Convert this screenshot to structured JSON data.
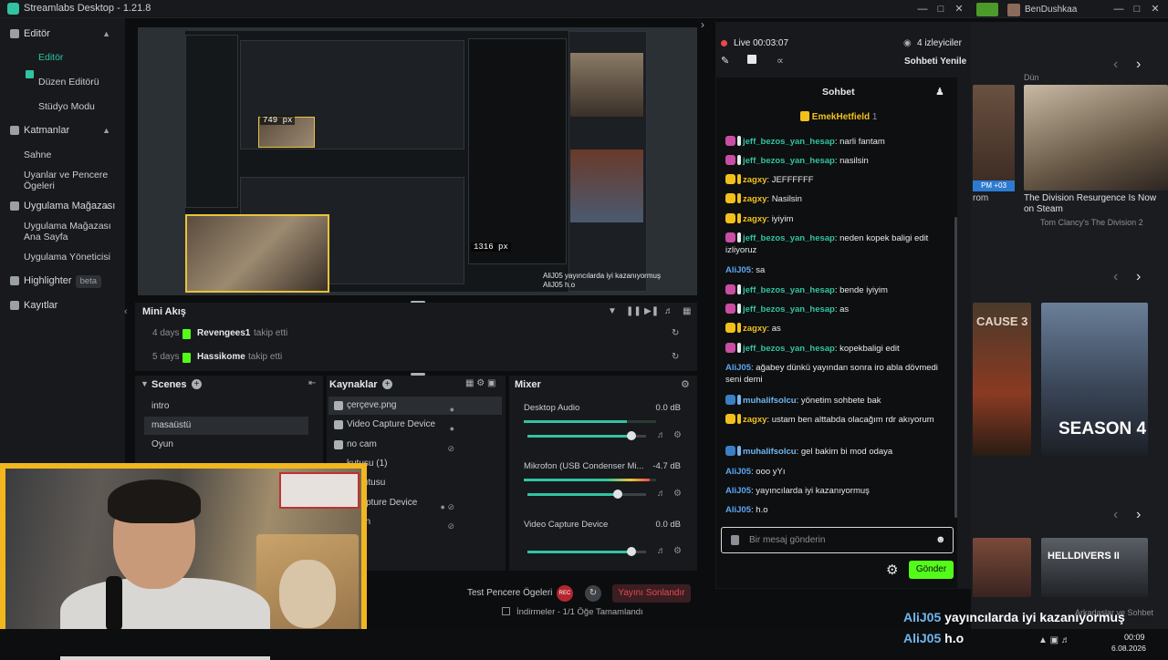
{
  "app": {
    "title": "Streamlabs Desktop - 1.21.8",
    "user": "BenDushkaa"
  },
  "sidebar": {
    "sections": [
      {
        "label": "Editör",
        "items": [
          "Editör",
          "Düzen Editörü",
          "Stüdyo Modu"
        ]
      },
      {
        "label": "Katmanlar",
        "items": [
          "Sahne",
          "Uyanlar ve Pencere Ögeleri"
        ]
      },
      {
        "label": "Uygulama Mağazası",
        "items": [
          "Uygulama Mağazası Ana Sayfa",
          "Uygulama Yöneticisi"
        ]
      }
    ],
    "highlighter": "Highlighter",
    "beta": "beta",
    "records": "Kayıtlar"
  },
  "preview": {
    "px_top": "749 px",
    "px_bottom": "1316 px",
    "inner_chat_1": "AliJ05 yayıncılarda iyi kazanıyormuş",
    "inner_chat_2": "AliJ05 h.o"
  },
  "minifeed": {
    "title": "Mini Akış",
    "rows": [
      {
        "days": "4 days",
        "name": "Revengees1",
        "action": "takip etti"
      },
      {
        "days": "5 days",
        "name": "Hassikome",
        "action": "takip etti"
      }
    ]
  },
  "scenes": {
    "title": "Scenes",
    "items": [
      "intro",
      "masaüstü",
      "Oyun"
    ],
    "selected": 1
  },
  "sources": {
    "title": "Kaynaklar",
    "items": [
      "çerçeve.png",
      "Video Capture Device",
      "no cam",
      "kutusu (1)",
      "et Kutusu",
      "o Capture Device",
      "Ekran",
      "kran"
    ]
  },
  "mixer": {
    "title": "Mixer",
    "channels": [
      {
        "name": "Desktop Audio",
        "db": "0.0 dB",
        "level": 0.78,
        "volume": 0.88
      },
      {
        "name": "Mikrofon (USB Condenser Mi...",
        "db": "-4.7 dB",
        "level": 0.95,
        "volume": 0.76
      },
      {
        "name": "Video Capture Device",
        "db": "0.0 dB",
        "level": 0,
        "volume": 0.88
      }
    ]
  },
  "controls": {
    "test": "Test Pencere Ögeleri",
    "rec": "REC",
    "end": "Yayını Sonlandır"
  },
  "live": {
    "status": "Live 00:03:07",
    "viewers": "4 izleyiciler",
    "refresh": "Sohbeti Yenile",
    "chat_title": "Sohbet",
    "pinned_user": "EmekHetfield",
    "pinned_count": "1"
  },
  "chat": [
    {
      "badge": "b-pink",
      "user": "jeff_bezos_yan_hesap",
      "cls": "u-green",
      "text": "narli fantam"
    },
    {
      "badge": "b-pink",
      "user": "jeff_bezos_yan_hesap",
      "cls": "u-green",
      "text": "nasilsin"
    },
    {
      "badge": "b-gold",
      "user": "zagxy",
      "cls": "u-gold",
      "text": "JEFFFFFF"
    },
    {
      "badge": "b-gold",
      "user": "zagxy",
      "cls": "u-gold",
      "text": "Nasilsin"
    },
    {
      "badge": "b-gold",
      "user": "zagxy",
      "cls": "u-gold",
      "text": "iyiyim"
    },
    {
      "badge": "b-pink",
      "user": "jeff_bezos_yan_hesap",
      "cls": "u-green",
      "text": "neden kopek baligi edit izliyoruz"
    },
    {
      "badge": "",
      "user": "AliJ05",
      "cls": "u-plain",
      "text": "sa"
    },
    {
      "badge": "b-pink",
      "user": "jeff_bezos_yan_hesap",
      "cls": "u-green",
      "text": "bende iyiyim"
    },
    {
      "badge": "b-pink",
      "user": "jeff_bezos_yan_hesap",
      "cls": "u-green",
      "text": "as"
    },
    {
      "badge": "b-gold",
      "user": "zagxy",
      "cls": "u-gold",
      "text": "as"
    },
    {
      "badge": "b-pink",
      "user": "jeff_bezos_yan_hesap",
      "cls": "u-green",
      "text": "kopekbaligi edit"
    },
    {
      "badge": "",
      "user": "AliJ05",
      "cls": "u-plain",
      "text": "ağabey dünkü yayından sonra iro abla dövmedi seni demi"
    },
    {
      "badge": "b-blue",
      "user": "muhalifsolcu",
      "cls": "u-blue",
      "text": "yönetim sohbete bak"
    },
    {
      "badge": "b-gold",
      "user": "zagxy",
      "cls": "u-gold",
      "text": "ustam ben alttabda olacağım rdr akıyorum"
    },
    {
      "badge": "b-blue",
      "user": "muhalifsolcu",
      "cls": "u-blue",
      "text": "gel bakim bi mod odaya"
    },
    {
      "badge": "",
      "user": "AliJ05",
      "cls": "u-plain",
      "text": "ooo yYı"
    },
    {
      "badge": "",
      "user": "AliJ05",
      "cls": "u-plain",
      "text": "yayıncılarda iyi kazanıyormuş"
    },
    {
      "badge": "",
      "user": "AliJ05",
      "cls": "u-plain",
      "text": "h.o"
    }
  ],
  "chat_input": {
    "placeholder": "Bir mesaj gönderin",
    "send": "Gönder"
  },
  "right": {
    "day": "Dün",
    "card_title": "The Division Resurgence Is Now on Steam",
    "card_sub": "Tom Clancy's The Division 2",
    "rom": "rom",
    "pm": "PM +03",
    "game_a": "CAUSE 3",
    "game_b": "SEASON 4",
    "game_c": "HELLDIVERS II",
    "friends": "Arkadaşlar ve Sohbet"
  },
  "toast": [
    {
      "user": "AliJ05",
      "text": "yayıncılarda iyi kazanıyormuş"
    },
    {
      "user": "AliJ05",
      "text": "h.o"
    }
  ],
  "taskbar": {
    "download": "İndirmeler - 1/1 Öğe Tamamlandı",
    "time": "00:09",
    "date": "6.08.2026"
  }
}
